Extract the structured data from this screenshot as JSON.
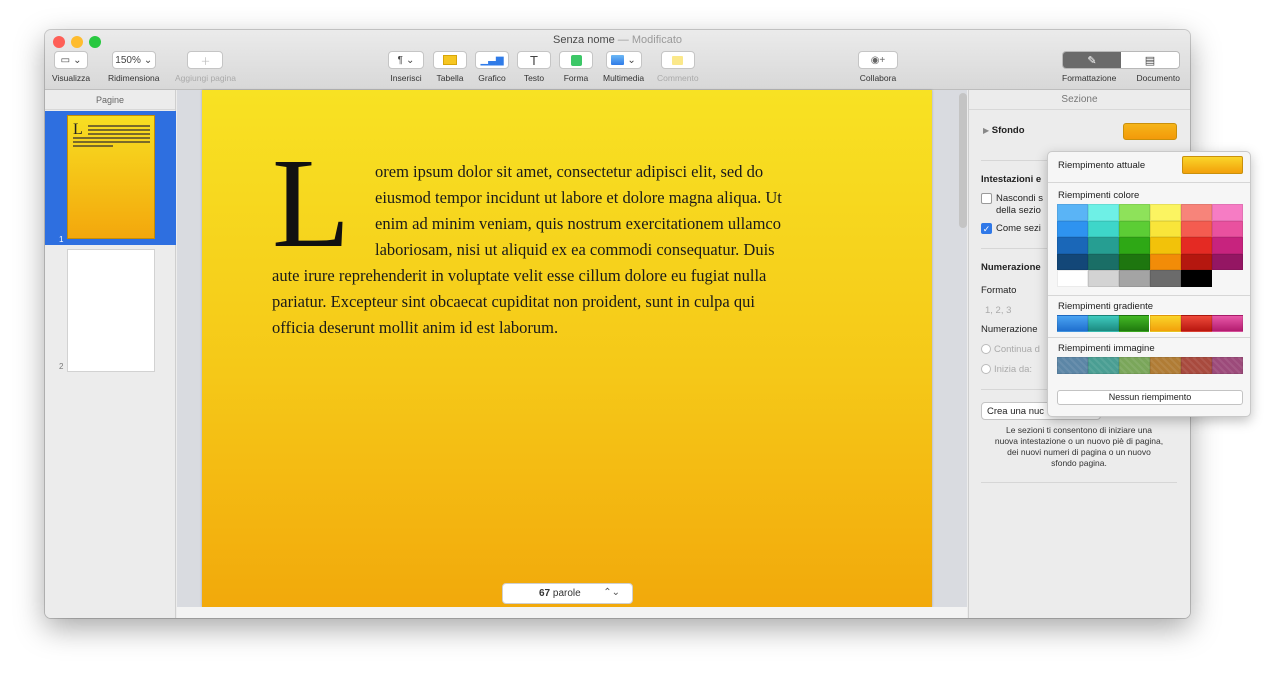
{
  "window": {
    "title": "Senza nome",
    "title_sep": " — ",
    "title_status": "Modificato",
    "traffic_colors": [
      "#fe5f57",
      "#febc2e",
      "#28c840"
    ]
  },
  "toolbar": {
    "zoom_value": "150%",
    "items": {
      "view": "Visualizza",
      "zoom": "Ridimensiona",
      "add_page": "Aggiungi pagina",
      "insert": "Inserisci",
      "table": "Tabella",
      "chart": "Grafico",
      "text": "Testo",
      "shape": "Forma",
      "media": "Multimedia",
      "comment": "Commento",
      "collaborate": "Collabora",
      "format": "Formattazione",
      "document": "Documento"
    }
  },
  "sidebar": {
    "header": "Pagine",
    "pages": [
      {
        "number": "1",
        "selected": true
      },
      {
        "number": "2",
        "selected": false
      }
    ]
  },
  "document": {
    "drop_cap": "L",
    "lines": [
      "orem ipsum dolor sit amet, consectetur adipisci elit, sed do",
      "eiusmod tempor incidunt ut labore et dolore magna aliqua. Ut",
      "enim ad minim veniam, quis nostrum exercitationem ullamco",
      "laboriosam, nisi ut aliquid ex ea commodi consequatur. Duis",
      "aute irure reprehenderit in voluptate velit esse cillum dolore eu fugiat nulla",
      "pariatur. Excepteur sint obcaecat cupiditat non proident, sunt in culpa qui",
      "officia deserunt mollit anim id est laborum."
    ],
    "word_count": "67",
    "word_unit": "parole"
  },
  "inspector": {
    "header": "Sezione",
    "background_label": "Sfondo",
    "background_color": "#f5b419",
    "headers_title": "Intestazioni e",
    "hide_label_1": "Nascondi s",
    "hide_label_2": "della sezio",
    "same_label": "Come sezi",
    "numbering_title": "Numerazione",
    "format_label": "Formato",
    "format_value": "1, 2, 3",
    "numbering_label": "Numerazione",
    "continue_label": "Continua d",
    "start_label": "Inizia da:",
    "create_button": "Crea una nuc",
    "description": [
      "Le sezioni ti consentono di iniziare una",
      "nuova intestazione o un nuovo piè di pagina,",
      "dei nuovi numeri di pagina o un nuovo",
      "sfondo pagina."
    ]
  },
  "popover": {
    "current_fill_label": "Riempimento attuale",
    "color_fills_label": "Riempimenti colore",
    "gradient_fills_label": "Riempimenti gradiente",
    "image_fills_label": "Riempimenti immagine",
    "no_fill_label": "Nessun riempimento",
    "color_grid": [
      [
        "#5ab4f6",
        "#6ef0e6",
        "#8ee25a",
        "#fbf461",
        "#f7847a",
        "#f67cc4"
      ],
      [
        "#2e93f0",
        "#3ed6c9",
        "#5ccd35",
        "#f9e53a",
        "#f45c50",
        "#e9519f"
      ],
      [
        "#1a67b8",
        "#269e92",
        "#2ea815",
        "#f2c20a",
        "#e42a23",
        "#c7237e"
      ],
      [
        "#134778",
        "#1a6e66",
        "#1e760f",
        "#f28c08",
        "#b5170f",
        "#941663"
      ],
      [
        "#ffffff",
        "#d3d3d3",
        "#a4a4a4",
        "#6b6b6b",
        "#000000",
        ""
      ]
    ],
    "gradient_fills": [
      [
        "#4aa3f2",
        "#1f6fce"
      ],
      [
        "#3fcbbf",
        "#1b8a80"
      ],
      [
        "#43b825",
        "#1f7a0e"
      ],
      [
        "#fad52a",
        "#f2a00a"
      ],
      [
        "#ee4a3a",
        "#b8160f"
      ],
      [
        "#e858a8",
        "#b31c6f"
      ]
    ],
    "image_fills": [
      "#5c86a6",
      "#4a9e93",
      "#7aa65a",
      "#b07c35",
      "#a84a3e",
      "#9c4a7a"
    ]
  }
}
